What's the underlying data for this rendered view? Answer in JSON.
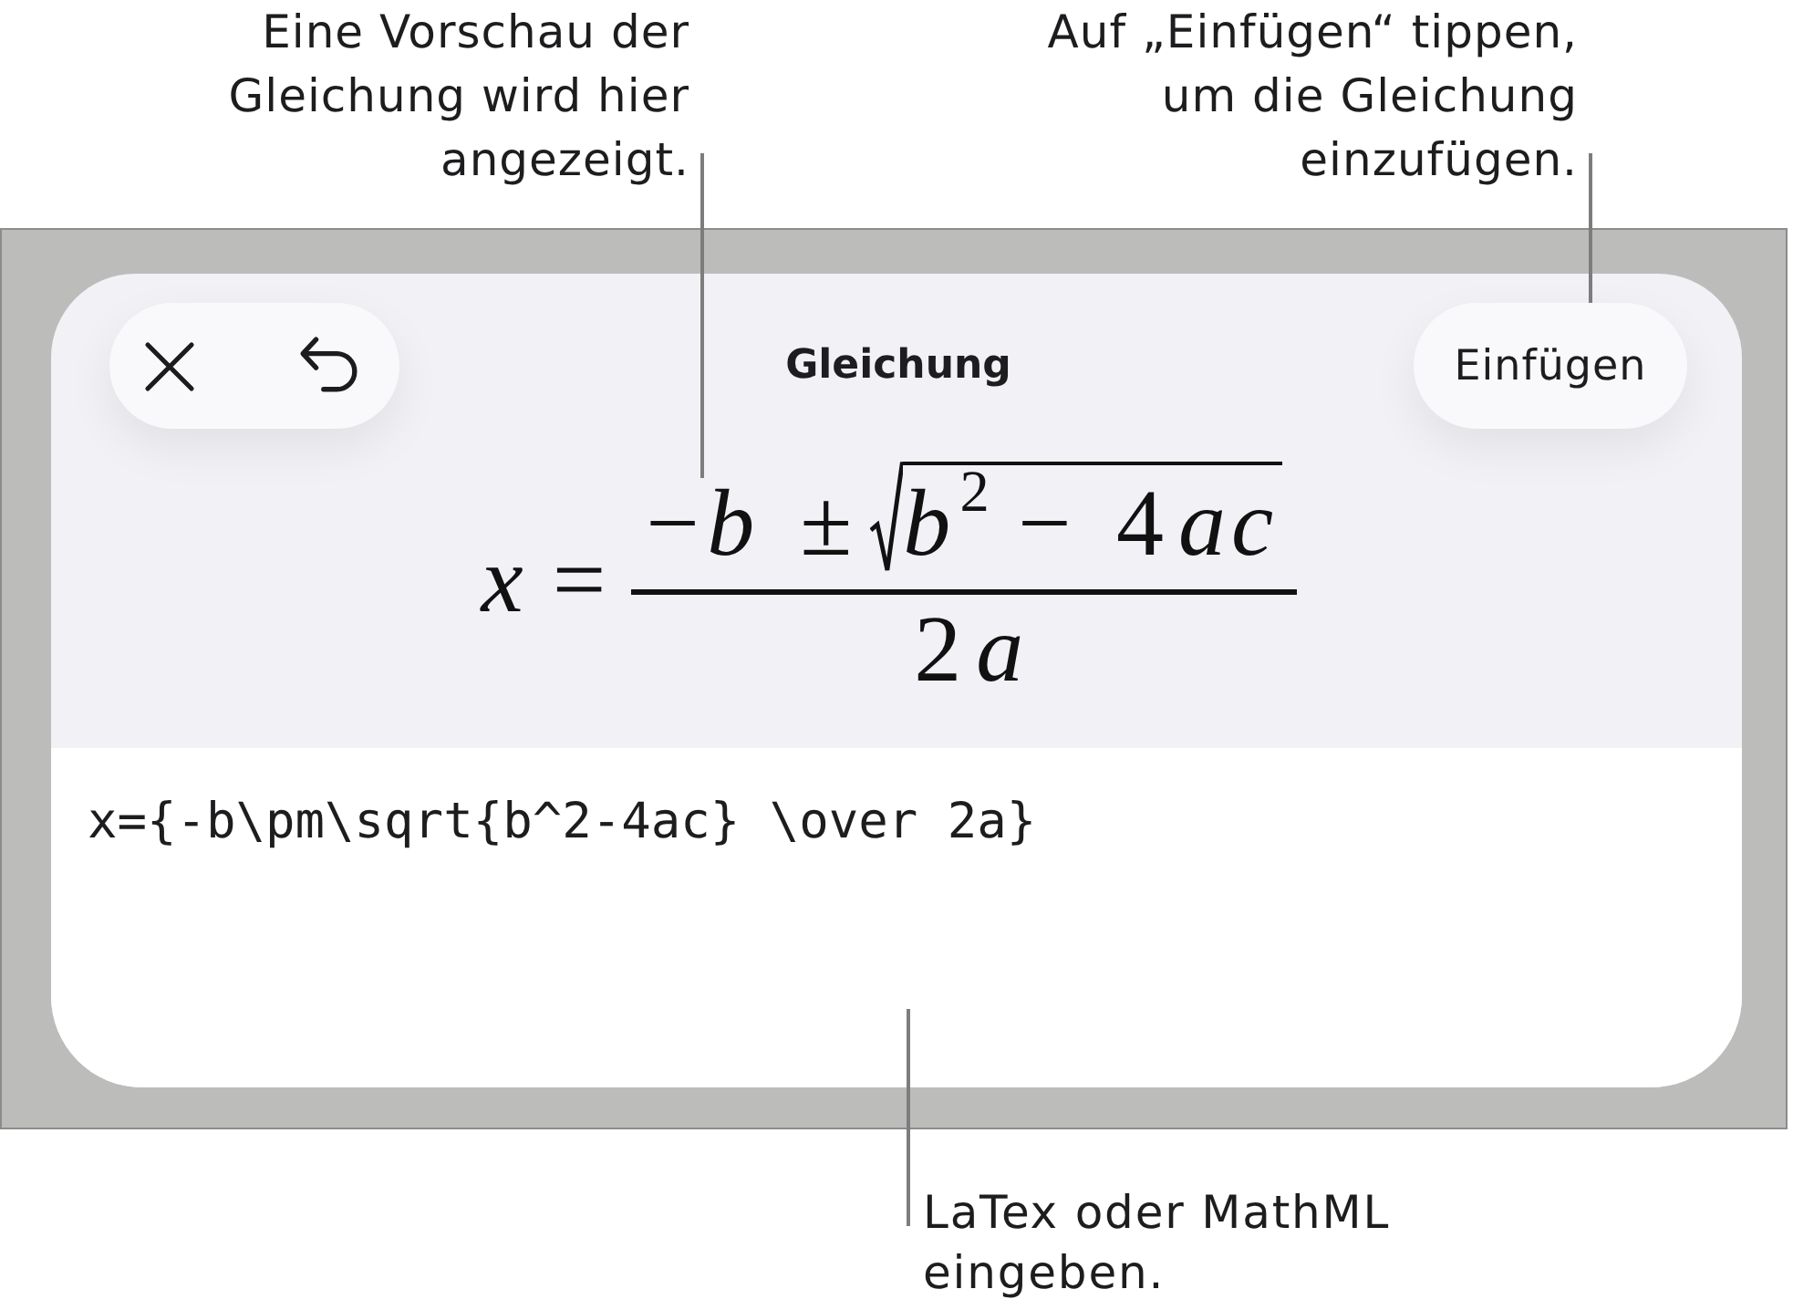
{
  "callouts": {
    "preview": "Eine Vorschau der\nGleichung wird hier\nangezeigt.",
    "insert": "Auf „Einfügen“ tippen,\num die Gleichung\neinzufügen.",
    "input": "LaTex oder MathML\neingeben."
  },
  "toolbar": {
    "title": "Gleichung",
    "insert_button": "Einfügen"
  },
  "preview": {
    "variable": "x",
    "relation": "=",
    "numerator": [
      {
        "kind": "sign",
        "text": "−"
      },
      {
        "kind": "var",
        "text": "b"
      },
      {
        "kind": "op",
        "text": "±"
      }
    ],
    "radicand": [
      {
        "kind": "var",
        "text": "b"
      },
      {
        "kind": "sup",
        "text": "2"
      },
      {
        "kind": "op",
        "text": "−"
      },
      {
        "kind": "num",
        "text": "4"
      },
      {
        "kind": "var",
        "text": "ac"
      }
    ],
    "denominator": [
      {
        "kind": "num",
        "text": "2"
      },
      {
        "kind": "var",
        "text": "a"
      }
    ]
  },
  "input": {
    "value": "x={-b\\pm\\sqrt{b^2-4ac} \\over 2a}"
  }
}
